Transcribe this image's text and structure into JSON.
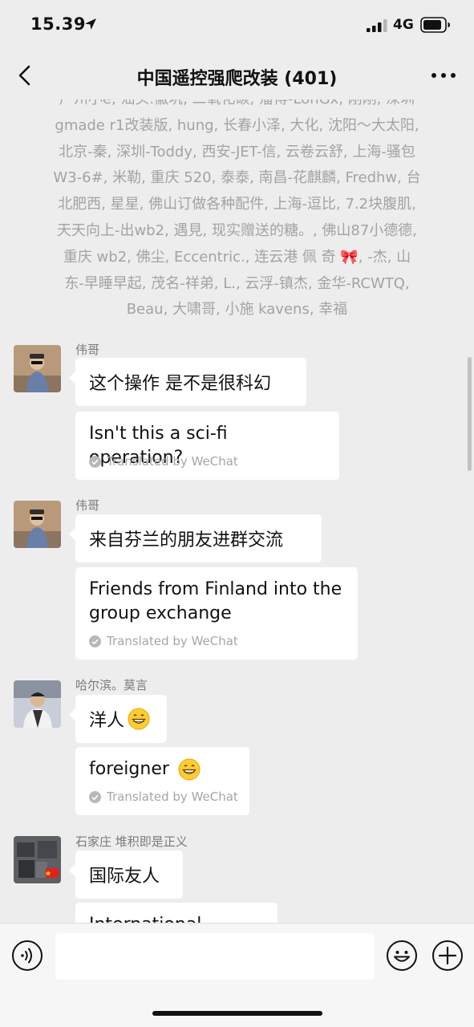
{
  "status_bar": {
    "time": "15.39",
    "network": "4G",
    "location_icon": "location-arrow-icon",
    "signal_icon": "signal-bars-icon",
    "battery_icon": "battery-icon"
  },
  "nav": {
    "title": "中国遥控强爬改装 (401)",
    "back_icon": "chevron-left-icon",
    "more_icon": "more-dots-icon"
  },
  "system_notice": {
    "lines": [
      "广州小e, 汕头.徽坑, 二氧化碳, 潘博-LonGx, 刚刚, 深圳",
      "gmade r1改装版, hung, 长春小泽, 大化, 沈阳～大太阳,",
      "北京-秦, 深圳-Toddy, 西安-JET-信, 云卷云舒, 上海-骚包",
      "W3-6#, 米勒, 重庆 520, 泰泰, 南昌-花麒麟, Fredhw, 台",
      "北肥西, 星星, 佛山订做各种配件, 上海-逗比, 7.2块腹肌,",
      "天天向上-出wb2, 遇見, 现实赠送的糖。, 佛山87小德德,",
      "重庆 wb2, 佛尘, Eccentric., 连云港  佩 奇 🎀, -杰, 山",
      "东-早睡早起, 茂名-祥弟, L., 云浮-镇杰, 金华-RCWTQ,",
      "Beau, 大啸哥, 小施 kavens, 幸福"
    ]
  },
  "messages": [
    {
      "sender": "伟哥",
      "text": "这个操作 是不是很科幻",
      "translation": "Isn't this a sci-fi operation?",
      "translation_note": "Translated by WeChat"
    },
    {
      "sender": "伟哥",
      "text": "来自芬兰的朋友进群交流",
      "translation_lines": [
        "Friends from Finland into the",
        "group exchange"
      ],
      "translation_note": "Translated by WeChat"
    },
    {
      "sender": "哈尔滨。莫言",
      "text": "洋人",
      "translation": "foreigner",
      "translation_note": "Translated by WeChat",
      "emoji": "grinning-face-icon"
    },
    {
      "sender": "石家庄 堆积即是正义",
      "text": "国际友人",
      "translation_partial": "International friends"
    }
  ],
  "input_bar": {
    "voice_icon": "voice-icon",
    "sticker_icon": "smiley-icon",
    "plus_icon": "plus-circle-icon"
  },
  "colors": {
    "background": "#ededed",
    "bubble": "#ffffff",
    "muted_text": "#a3a3a3"
  }
}
